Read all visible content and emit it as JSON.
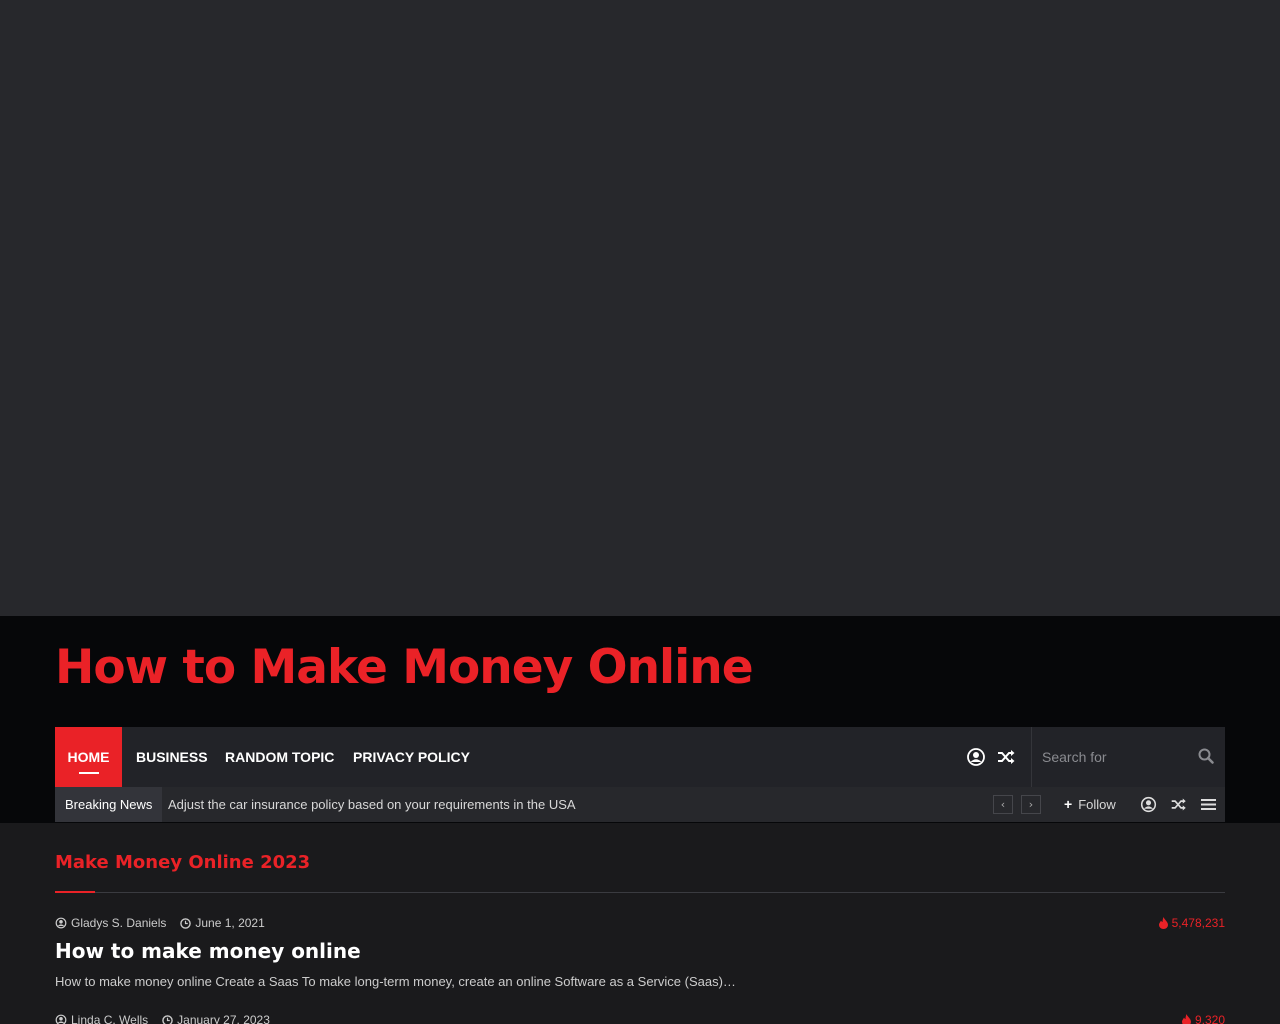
{
  "site": {
    "title": "How to Make Money Online"
  },
  "nav": {
    "items": [
      {
        "label": "HOME",
        "active": true
      },
      {
        "label": "BUSINESS"
      },
      {
        "label": "RANDOM TOPIC"
      },
      {
        "label": "PRIVACY POLICY"
      }
    ],
    "icons": [
      "user-icon",
      "shuffle-icon"
    ],
    "search": {
      "placeholder": "Search for",
      "icon": "search-icon"
    }
  },
  "breaking": {
    "label": "Breaking News",
    "headline": "Adjust the car insurance policy based on your requirements in the USA",
    "prev": "‹",
    "next": "›",
    "follow": "Follow",
    "icons": [
      "user-icon",
      "shuffle-icon",
      "menu-icon"
    ]
  },
  "section": {
    "title": "Make Money Online 2023"
  },
  "posts": [
    {
      "author": "Gladys S. Daniels",
      "date": "June 1, 2021",
      "views": "5,478,231",
      "title": "How to make money online",
      "excerpt": "How to make money online Create a Saas To make long-term money, create an online Software as a Service (Saas)…"
    },
    {
      "author": "Linda C. Wells",
      "date": "January 27, 2023",
      "views": "9,320"
    }
  ],
  "colors": {
    "accent": "#ea2227",
    "header_bg": "#060709",
    "nav_bg": "#222328",
    "page_bg": "#1a1a1c",
    "top_bg": "#27282c"
  }
}
